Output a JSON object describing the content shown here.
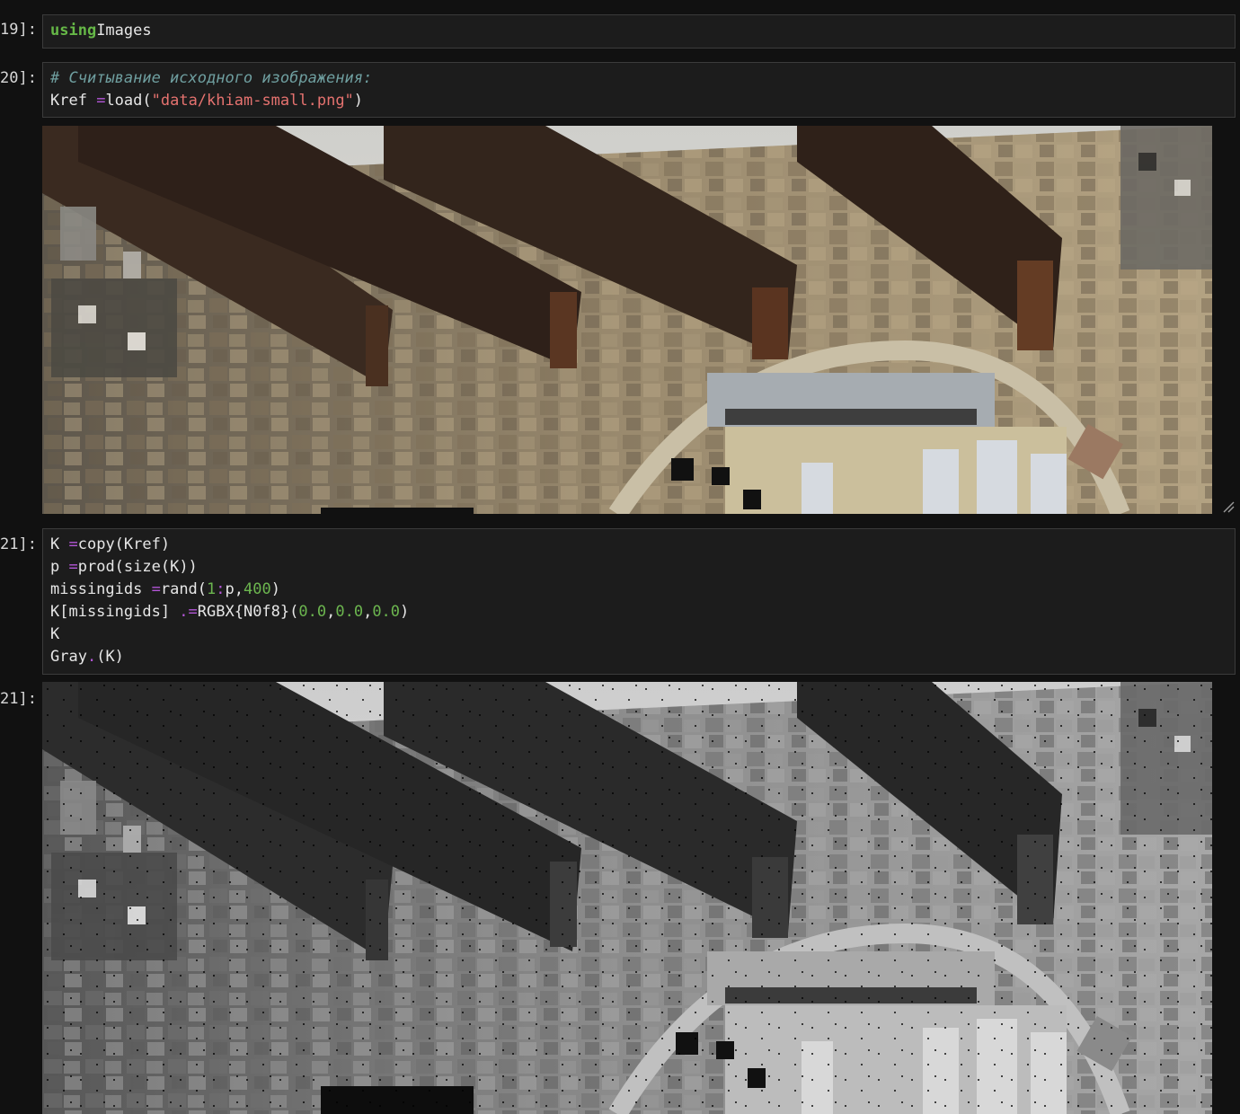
{
  "cells": [
    {
      "prompt": "19]:",
      "lines": [
        [
          [
            "kw",
            "using"
          ],
          [
            "",
            "Images"
          ]
        ]
      ]
    },
    {
      "prompt": "20]:",
      "lines": [
        [
          [
            "cmt",
            "# Считывание исходного изображения:"
          ]
        ],
        [
          [
            "",
            "Kref "
          ],
          [
            "op",
            "="
          ],
          [
            "",
            "load("
          ],
          [
            "str",
            "\"data/khiam-small.png\""
          ],
          [
            "",
            ")"
          ]
        ]
      ]
    },
    {
      "prompt": "21]:",
      "lines": [
        [
          [
            "",
            "K "
          ],
          [
            "op",
            "="
          ],
          [
            "",
            "copy(Kref)"
          ]
        ],
        [
          [
            "",
            "p "
          ],
          [
            "op",
            "="
          ],
          [
            "",
            "prod(size(K))"
          ]
        ],
        [
          [
            "",
            "missingids "
          ],
          [
            "op",
            "="
          ],
          [
            "",
            "rand("
          ],
          [
            "num",
            "1"
          ],
          [
            "op",
            ":"
          ],
          [
            "",
            "p,"
          ],
          [
            "num",
            "400"
          ],
          [
            "",
            ")"
          ]
        ],
        [
          [
            "",
            "K[missingids] "
          ],
          [
            "op",
            ".="
          ],
          [
            "",
            "RGBX{N0f8}("
          ],
          [
            "num",
            "0.0"
          ],
          [
            "",
            ","
          ],
          [
            "num",
            "0.0"
          ],
          [
            "",
            ","
          ],
          [
            "num",
            "0.0"
          ],
          [
            "",
            ")"
          ]
        ],
        [
          [
            "",
            "K"
          ]
        ],
        [
          [
            "",
            "Gray"
          ],
          [
            "op",
            "."
          ],
          [
            "",
            "(K)"
          ]
        ]
      ]
    }
  ],
  "outputs": [
    {
      "prompt": "",
      "alt": "Интерьер с каменными стенами и деревянными балками (цветное изображение)",
      "mode": "color"
    },
    {
      "prompt": "21]:",
      "alt": "То же изображение в оттенках серого с пропущенными пикселями",
      "mode": "gray"
    }
  ],
  "colors": {
    "background": "#111111",
    "cell_bg": "#1c1c1c",
    "keyword": "#66b847",
    "string": "#e5726f",
    "comment": "#6f9fa0",
    "operator": "#b456d8",
    "number": "#6cb64f"
  }
}
